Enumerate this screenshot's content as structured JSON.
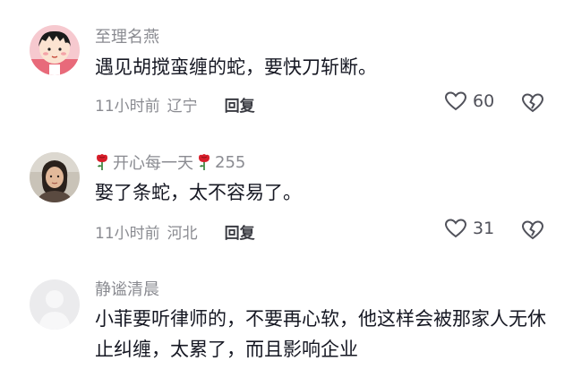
{
  "comments": [
    {
      "username": "至理名燕",
      "text": "遇见胡搅蛮缠的蛇，要快刀斩断。",
      "time": "11小时前",
      "location": "辽宁",
      "reply_label": "回复",
      "like_count": "60",
      "avatar_icon": "cartoon-girl-avatar"
    },
    {
      "username": "开心每一天",
      "fans_count": "255",
      "text": "娶了条蛇，太不容易了。",
      "time": "11小时前",
      "location": "河北",
      "reply_label": "回复",
      "like_count": "31",
      "avatar_icon": "woman-photo-avatar",
      "name_decoration_icon": "rose-icon"
    },
    {
      "username": "静谧清晨",
      "text": "小菲要听律师的，不要再心软，他这样会被那家人无休止纠缠，太累了，而且影响企业",
      "avatar_icon": "default-gray-avatar"
    }
  ],
  "colors": {
    "meta": "#8a8b91",
    "text": "#161823",
    "rose": "#d81e2a"
  }
}
